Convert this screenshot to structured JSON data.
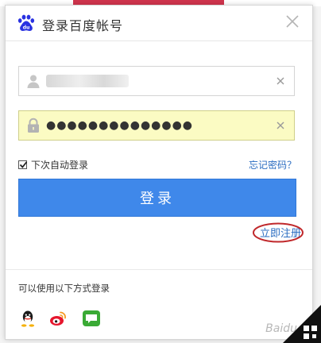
{
  "header": {
    "title": "登录百度帐号",
    "logo_icon": "baidu-paw-logo"
  },
  "username": {
    "value": "",
    "placeholder": ""
  },
  "password": {
    "value": "●●●●●●●●●●●●●●",
    "placeholder": ""
  },
  "remember": {
    "label": "下次自动登录",
    "checked": true
  },
  "forgot": {
    "label": "忘记密码？"
  },
  "login_button": {
    "label": "登录"
  },
  "register": {
    "label": "立即注册"
  },
  "alt_login": {
    "label": "可以使用以下方式登录",
    "providers": [
      "qq-icon",
      "weibo-icon",
      "wechat-icon"
    ]
  },
  "colors": {
    "primary": "#3f88ea",
    "link": "#2a6cc1",
    "autofill": "#fbfbc3",
    "annotation": "#c0282b"
  }
}
